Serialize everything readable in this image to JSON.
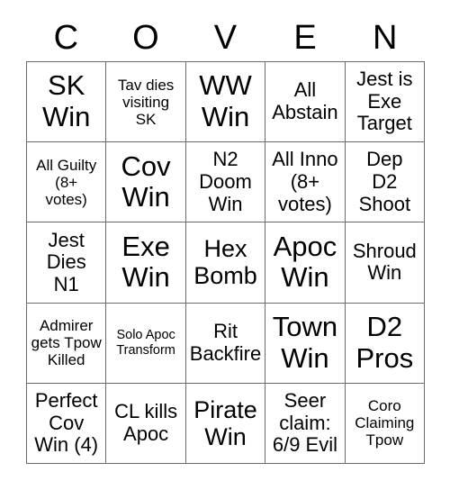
{
  "card": {
    "header_letters": [
      "C",
      "O",
      "V",
      "E",
      "N"
    ],
    "rows": [
      [
        {
          "text": "SK\nWin",
          "size": "xl"
        },
        {
          "text": "Tav dies\nvisiting\nSK",
          "size": "sm"
        },
        {
          "text": "WW\nWin",
          "size": "xl"
        },
        {
          "text": "All\nAbstain",
          "size": "md"
        },
        {
          "text": "Jest is\nExe\nTarget",
          "size": "md"
        }
      ],
      [
        {
          "text": "All Guilty\n(8+\nvotes)",
          "size": "sm"
        },
        {
          "text": "Cov\nWin",
          "size": "xl"
        },
        {
          "text": "N2\nDoom\nWin",
          "size": "md"
        },
        {
          "text": "All Inno\n(8+\nvotes)",
          "size": "md"
        },
        {
          "text": "Dep\nD2\nShoot",
          "size": "md"
        }
      ],
      [
        {
          "text": "Jest\nDies\nN1",
          "size": "md"
        },
        {
          "text": "Exe\nWin",
          "size": "xl"
        },
        {
          "text": "Hex\nBomb",
          "size": "lg"
        },
        {
          "text": "Apoc\nWin",
          "size": "xl"
        },
        {
          "text": "Shroud\nWin",
          "size": "md"
        }
      ],
      [
        {
          "text": "Admirer\ngets Tpow\nKilled",
          "size": "sm"
        },
        {
          "text": "Solo Apoc\nTransform",
          "size": "xs"
        },
        {
          "text": "Rit\nBackfire",
          "size": "md"
        },
        {
          "text": "Town\nWin",
          "size": "xl"
        },
        {
          "text": "D2\nPros",
          "size": "xl"
        }
      ],
      [
        {
          "text": "Perfect\nCov\nWin (4)",
          "size": "md"
        },
        {
          "text": "CL kills\nApoc",
          "size": "md"
        },
        {
          "text": "Pirate\nWin",
          "size": "lg"
        },
        {
          "text": "Seer\nclaim:\n6/9 Evil",
          "size": "md"
        },
        {
          "text": "Coro\nClaiming\nTpow",
          "size": "sm"
        }
      ]
    ]
  },
  "colors": {
    "background": "#ffffff",
    "text": "#000000",
    "grid_line": "#6b6b6b"
  }
}
